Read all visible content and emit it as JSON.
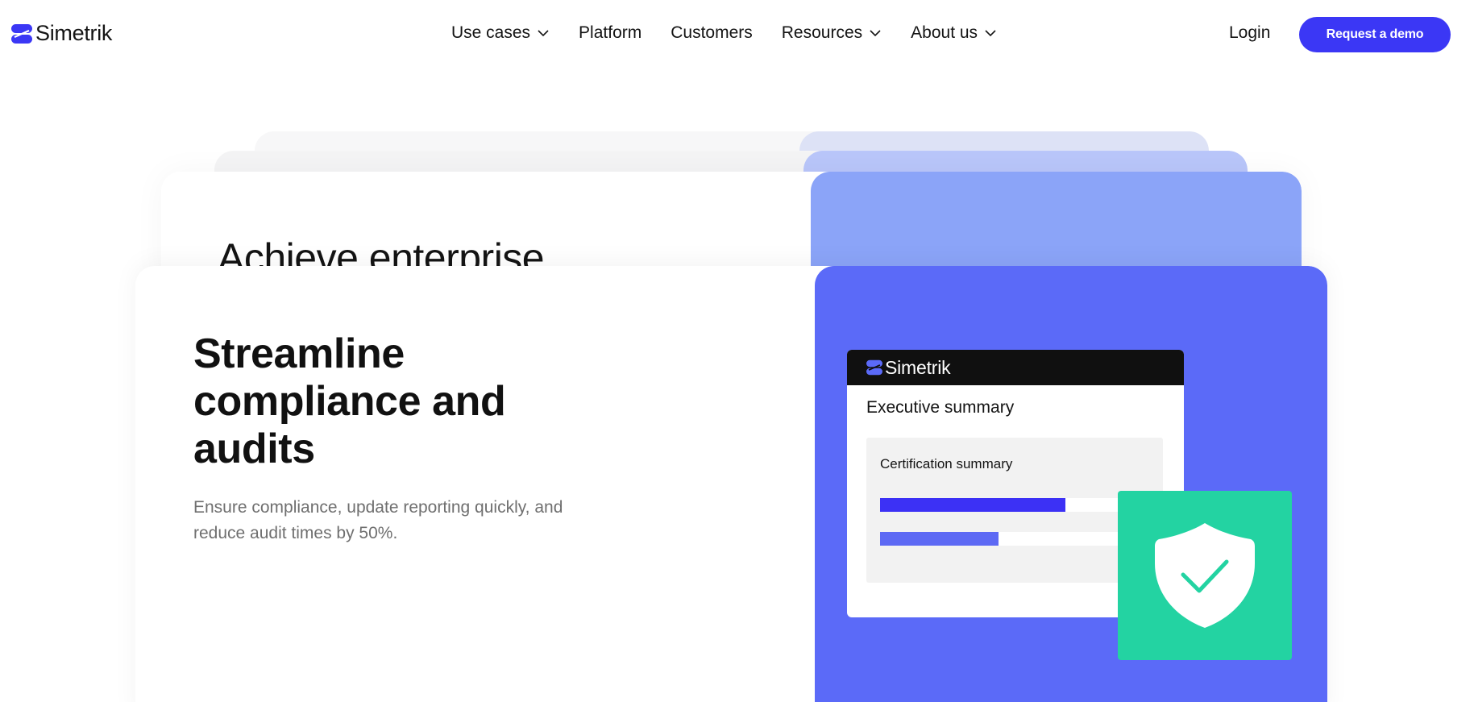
{
  "brand": {
    "name": "Simetrik",
    "color": "#3b37f5"
  },
  "nav": {
    "items": [
      {
        "label": "Use cases",
        "has_dropdown": true
      },
      {
        "label": "Platform",
        "has_dropdown": false
      },
      {
        "label": "Customers",
        "has_dropdown": false
      },
      {
        "label": "Resources",
        "has_dropdown": true
      },
      {
        "label": "About us",
        "has_dropdown": true
      }
    ],
    "login_label": "Login",
    "cta_label": "Request a demo"
  },
  "cards": {
    "back_title": "Achieve enterprise",
    "front": {
      "title": "Streamline compliance and audits",
      "description": "Ensure compliance, update reporting quickly, and reduce audit times by 50%.",
      "panel_color": "#5b6af8"
    }
  },
  "report": {
    "brand": "Simetrik",
    "heading": "Executive summary",
    "cert_title": "Certification summary",
    "bars": [
      {
        "progress": 0.69,
        "color": "#3c31f5"
      },
      {
        "progress": 0.44,
        "color": "#5d69f4"
      }
    ]
  },
  "badge": {
    "icon": "shield-check-icon",
    "color": "#23d3a2",
    "check_color": "#23d3a2"
  }
}
